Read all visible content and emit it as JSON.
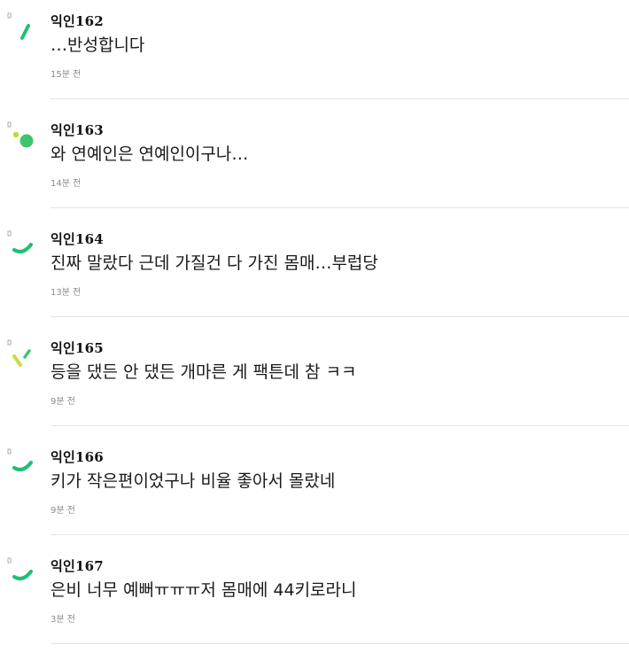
{
  "comments": [
    {
      "author": "익인162",
      "text": "…반성합니다",
      "time": "15분 전",
      "avatar_icon": "green-slash-icon"
    },
    {
      "author": "익인163",
      "text": "와 연예인은 연예인이구나…",
      "time": "14분 전",
      "avatar_icon": "green-dots-icon"
    },
    {
      "author": "익인164",
      "text": "진짜 말랐다 근데 가질건 다 가진 몸매…부럽당",
      "time": "13분 전",
      "avatar_icon": "green-smile-icon"
    },
    {
      "author": "익인165",
      "text": "등을 댔든 안 댔든 개마른 게 팩튼데 참 ㅋㅋ",
      "time": "9분 전",
      "avatar_icon": "lime-check-icon"
    },
    {
      "author": "익인166",
      "text": "키가 작은편이었구나 비율 좋아서 몰랐네",
      "time": "9분 전",
      "avatar_icon": "green-smile-icon"
    },
    {
      "author": "익인167",
      "text": "은비 너무 예뻐ㅠㅠㅠ저 몸매에 44키로라니",
      "time": "3분 전",
      "avatar_icon": "green-smile-icon"
    }
  ],
  "colors": {
    "accent_green": "#1fbf73",
    "light_green": "#3ec46d",
    "lime": "#c9dc3c",
    "divider": "#e4e4e4",
    "time_text": "#8a8a8a"
  }
}
